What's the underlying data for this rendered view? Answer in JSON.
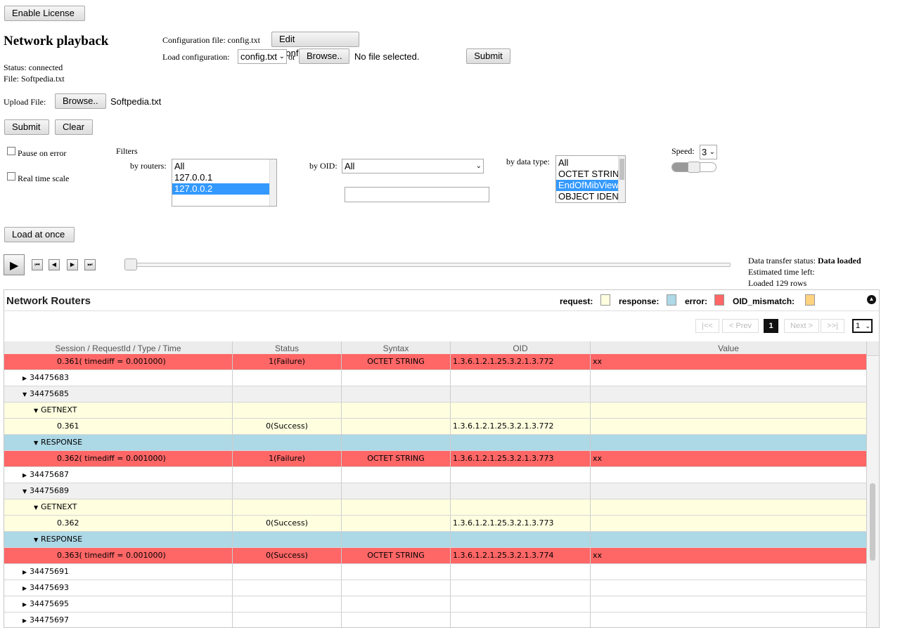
{
  "top": {
    "enable_license": "Enable License",
    "title": "Network playback",
    "status": "Status: connected",
    "file": "File: Softpedia.txt"
  },
  "config": {
    "file_label": "Configuration file: config.txt",
    "edit_button": "Edit Configuration",
    "load_label": "Load configuration:",
    "load_selected": "config.txt",
    "or_text": "or",
    "browse_button": "Browse..",
    "no_file": "No file selected.",
    "submit_button": "Submit"
  },
  "upload": {
    "label": "Upload File:",
    "browse_button": "Browse..",
    "file_name": "Softpedia.txt",
    "submit_button": "Submit",
    "clear_button": "Clear"
  },
  "options": {
    "pause_on_error": "Pause on error",
    "real_time_scale": "Real time scale"
  },
  "filters": {
    "title": "Filters",
    "routers_label": "by routers:",
    "routers": [
      "All",
      "127.0.0.1",
      "127.0.0.2"
    ],
    "routers_selected": "127.0.0.2",
    "oid_label": "by OID:",
    "oid_selected": "All",
    "oid_text": "",
    "datatype_label": "by data type:",
    "datatypes": [
      "All",
      "OCTET STRIN",
      "EndOfMibView",
      "OBJECT IDEN"
    ],
    "datatype_selected": "EndOfMibView",
    "speed_label": "Speed:",
    "speed_value": "3"
  },
  "playback": {
    "load_at_once": "Load at once",
    "transfer_status_label": "Data transfer status:",
    "transfer_status_value": "Data loaded",
    "time_left": "Estimated time left:",
    "loaded_rows": "Loaded 129 rows"
  },
  "grid": {
    "title": "Network Routers",
    "legend": [
      {
        "label": "request:",
        "color": "#ffffe0"
      },
      {
        "label": "response:",
        "color": "#add8e6"
      },
      {
        "label": "error:",
        "color": "#ff6666"
      },
      {
        "label": "OID_mismatch:",
        "color": "#ffd27f"
      }
    ],
    "pager": {
      "first": "|<<",
      "prev": "< Prev",
      "current": "1",
      "next": "Next >",
      "last": ">>|",
      "page_select": "1"
    },
    "columns": [
      "Session / RequestId / Type / Time",
      "Status",
      "Syntax",
      "OID",
      "Value"
    ],
    "rows": [
      {
        "kind": "error",
        "indent": 3,
        "tri": "",
        "c1": "0.361( timediff = 0.001000)",
        "c2": "1(Failure)",
        "c3": "OCTET STRING",
        "c4": "1.3.6.1.2.1.25.3.2.1.3.772",
        "c5": "xx"
      },
      {
        "kind": "plain",
        "indent": 1,
        "tri": "▶",
        "c1": "34475683",
        "c2": "",
        "c3": "",
        "c4": "",
        "c5": ""
      },
      {
        "kind": "group",
        "indent": 1,
        "tri": "▼",
        "c1": "34475685",
        "c2": "",
        "c3": "",
        "c4": "",
        "c5": ""
      },
      {
        "kind": "request",
        "indent": 2,
        "tri": "▼",
        "c1": "GETNEXT",
        "c2": "",
        "c3": "",
        "c4": "",
        "c5": ""
      },
      {
        "kind": "request",
        "indent": 3,
        "tri": "",
        "c1": "0.361",
        "c2": "0(Success)",
        "c3": "",
        "c4": "1.3.6.1.2.1.25.3.2.1.3.772",
        "c5": ""
      },
      {
        "kind": "response",
        "indent": 2,
        "tri": "▼",
        "c1": "RESPONSE",
        "c2": "",
        "c3": "",
        "c4": "",
        "c5": ""
      },
      {
        "kind": "error",
        "indent": 3,
        "tri": "",
        "c1": "0.362( timediff = 0.001000)",
        "c2": "1(Failure)",
        "c3": "OCTET STRING",
        "c4": "1.3.6.1.2.1.25.3.2.1.3.773",
        "c5": "xx"
      },
      {
        "kind": "plain",
        "indent": 1,
        "tri": "▶",
        "c1": "34475687",
        "c2": "",
        "c3": "",
        "c4": "",
        "c5": ""
      },
      {
        "kind": "group",
        "indent": 1,
        "tri": "▼",
        "c1": "34475689",
        "c2": "",
        "c3": "",
        "c4": "",
        "c5": ""
      },
      {
        "kind": "request",
        "indent": 2,
        "tri": "▼",
        "c1": "GETNEXT",
        "c2": "",
        "c3": "",
        "c4": "",
        "c5": ""
      },
      {
        "kind": "request",
        "indent": 3,
        "tri": "",
        "c1": "0.362",
        "c2": "0(Success)",
        "c3": "",
        "c4": "1.3.6.1.2.1.25.3.2.1.3.773",
        "c5": ""
      },
      {
        "kind": "response",
        "indent": 2,
        "tri": "▼",
        "c1": "RESPONSE",
        "c2": "",
        "c3": "",
        "c4": "",
        "c5": ""
      },
      {
        "kind": "error",
        "indent": 3,
        "tri": "",
        "c1": "0.363( timediff = 0.001000)",
        "c2": "0(Success)",
        "c3": "OCTET STRING",
        "c4": "1.3.6.1.2.1.25.3.2.1.3.774",
        "c5": "xx"
      },
      {
        "kind": "plain",
        "indent": 1,
        "tri": "▶",
        "c1": "34475691",
        "c2": "",
        "c3": "",
        "c4": "",
        "c5": ""
      },
      {
        "kind": "plain",
        "indent": 1,
        "tri": "▶",
        "c1": "34475693",
        "c2": "",
        "c3": "",
        "c4": "",
        "c5": ""
      },
      {
        "kind": "plain",
        "indent": 1,
        "tri": "▶",
        "c1": "34475695",
        "c2": "",
        "c3": "",
        "c4": "",
        "c5": ""
      },
      {
        "kind": "plain",
        "indent": 1,
        "tri": "▶",
        "c1": "34475697",
        "c2": "",
        "c3": "",
        "c4": "",
        "c5": ""
      }
    ],
    "row_colors": {
      "error": "#ff6666",
      "plain": "#ffffff",
      "group": "#f0f0f0",
      "request": "#ffffe0",
      "response": "#add8e6"
    }
  }
}
